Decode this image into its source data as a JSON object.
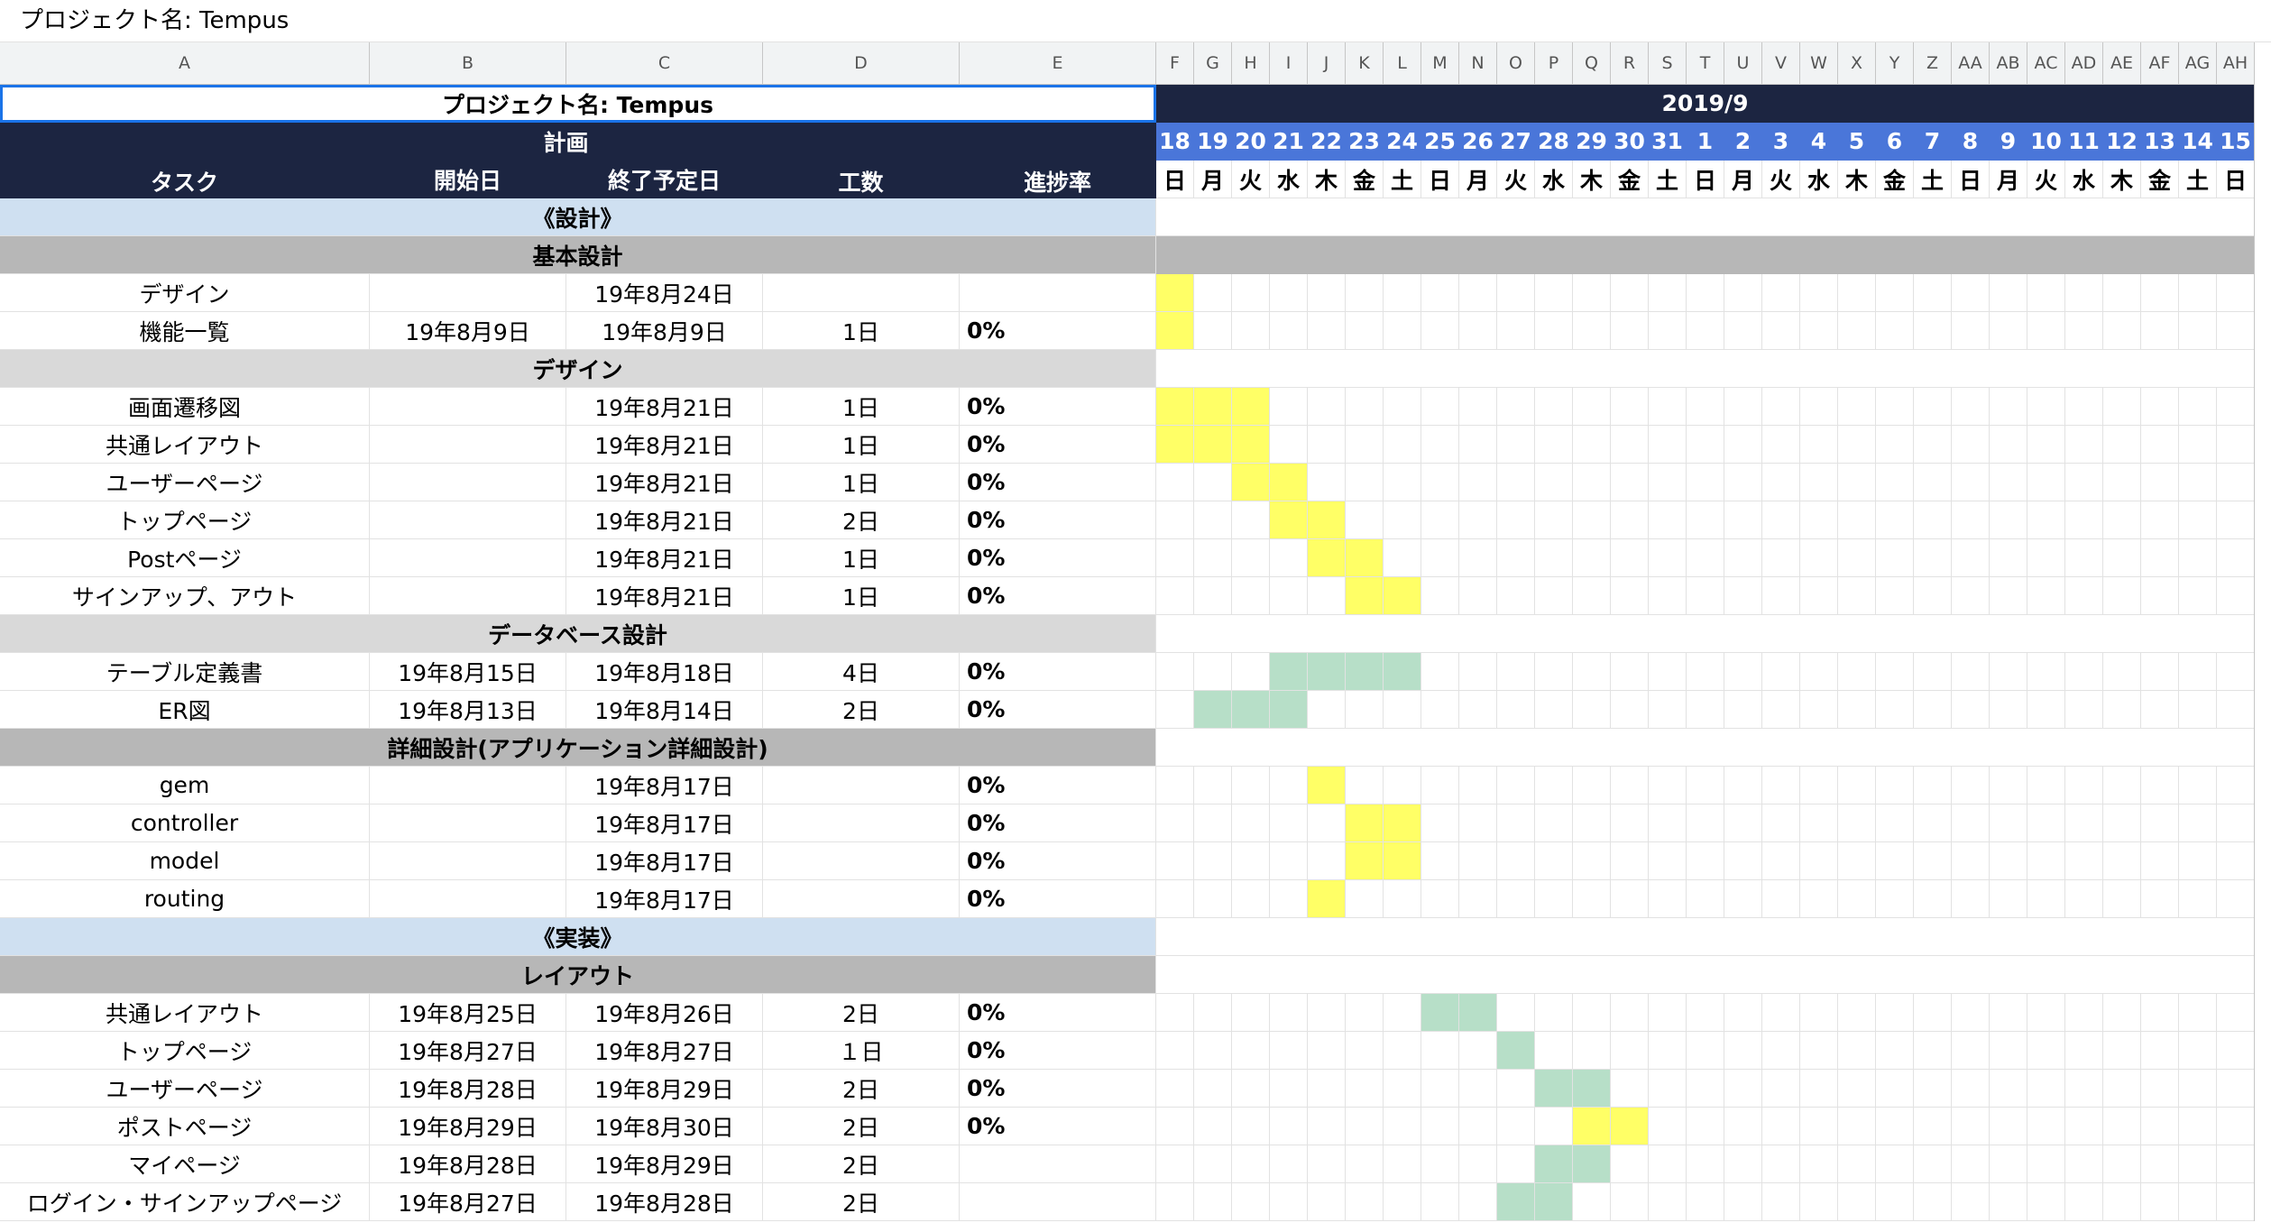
{
  "formula_bar": {
    "value": "プロジェクト名: Tempus"
  },
  "colors": {
    "navy": "#1c2541",
    "date_blue": "#4a76d9",
    "phase_blue": "#cfe0f1",
    "category_dark_gray": "#b7b7b7",
    "category_light_gray": "#d9d9d9",
    "bar_yellow": "#ffff66",
    "bar_green": "#b7dfc8"
  },
  "columns": [
    "A",
    "B",
    "C",
    "D",
    "E",
    "F",
    "G",
    "H",
    "I",
    "J",
    "K",
    "L",
    "M",
    "N",
    "O",
    "P",
    "Q",
    "R",
    "S",
    "T",
    "U",
    "V",
    "W",
    "X",
    "Y",
    "Z",
    "AA",
    "AB",
    "AC",
    "AD",
    "AE",
    "AF",
    "AG",
    "AH"
  ],
  "sheet": {
    "project_title": "プロジェクト名: Tempus",
    "month_label": "2019/9",
    "plan_label": "計画",
    "headers": {
      "task": "タスク",
      "start": "開始日",
      "end": "終了予定日",
      "effort": "工数",
      "progress": "進捗率"
    },
    "dates": [
      "18",
      "19",
      "20",
      "21",
      "22",
      "23",
      "24",
      "25",
      "26",
      "27",
      "28",
      "29",
      "30",
      "31",
      "1",
      "2",
      "3",
      "4",
      "5",
      "6",
      "7",
      "8",
      "9",
      "10",
      "11",
      "12",
      "13",
      "14",
      "15"
    ],
    "weekdays": [
      "日",
      "月",
      "火",
      "水",
      "木",
      "金",
      "土",
      "日",
      "月",
      "火",
      "水",
      "木",
      "金",
      "土",
      "日",
      "月",
      "火",
      "水",
      "木",
      "金",
      "土",
      "日",
      "月",
      "火",
      "水",
      "木",
      "金",
      "土",
      "日"
    ]
  },
  "rows": [
    {
      "type": "phase",
      "label": "《設計》"
    },
    {
      "type": "category",
      "shade": "dark",
      "label": "基本設計",
      "gantt_bar": true
    },
    {
      "type": "task",
      "task": "デザイン",
      "start": "",
      "end": "19年8月24日",
      "effort": "",
      "progress": "",
      "yellow": [
        0
      ],
      "green": []
    },
    {
      "type": "task",
      "task": "機能一覧",
      "start": "19年8月9日",
      "end": "19年8月9日",
      "effort": "1日",
      "progress": "0%",
      "yellow": [
        0
      ],
      "green": []
    },
    {
      "type": "category",
      "shade": "light",
      "label": "デザイン",
      "gantt_bar": false
    },
    {
      "type": "task",
      "task": "画面遷移図",
      "start": "",
      "end": "19年8月21日",
      "effort": "1日",
      "progress": "0%",
      "yellow": [
        0,
        1,
        2
      ],
      "green": []
    },
    {
      "type": "task",
      "task": "共通レイアウト",
      "start": "",
      "end": "19年8月21日",
      "effort": "1日",
      "progress": "0%",
      "yellow": [
        0,
        1,
        2
      ],
      "green": []
    },
    {
      "type": "task",
      "task": "ユーザーページ",
      "start": "",
      "end": "19年8月21日",
      "effort": "1日",
      "progress": "0%",
      "yellow": [
        2,
        3
      ],
      "green": []
    },
    {
      "type": "task",
      "task": "トップページ",
      "start": "",
      "end": "19年8月21日",
      "effort": "2日",
      "progress": "0%",
      "yellow": [
        3,
        4
      ],
      "green": []
    },
    {
      "type": "task",
      "task": "Postページ",
      "start": "",
      "end": "19年8月21日",
      "effort": "1日",
      "progress": "0%",
      "yellow": [
        4,
        5
      ],
      "green": []
    },
    {
      "type": "task",
      "task": "サインアップ、アウト",
      "start": "",
      "end": "19年8月21日",
      "effort": "1日",
      "progress": "0%",
      "yellow": [
        5,
        6
      ],
      "green": []
    },
    {
      "type": "category",
      "shade": "light",
      "label": "データベース設計",
      "gantt_bar": false
    },
    {
      "type": "task",
      "task": "テーブル定義書",
      "start": "19年8月15日",
      "end": "19年8月18日",
      "effort": "4日",
      "progress": "0%",
      "yellow": [],
      "green": [
        3,
        4,
        5,
        6
      ]
    },
    {
      "type": "task",
      "task": "ER図",
      "start": "19年8月13日",
      "end": "19年8月14日",
      "effort": "2日",
      "progress": "0%",
      "yellow": [],
      "green": [
        1,
        2,
        3
      ]
    },
    {
      "type": "category",
      "shade": "dark",
      "label": "詳細設計(アプリケーション詳細設計)",
      "gantt_bar": false
    },
    {
      "type": "task",
      "task": "gem",
      "start": "",
      "end": "19年8月17日",
      "effort": "",
      "progress": "0%",
      "yellow": [
        4
      ],
      "green": []
    },
    {
      "type": "task",
      "task": "controller",
      "start": "",
      "end": "19年8月17日",
      "effort": "",
      "progress": "0%",
      "yellow": [
        5,
        6
      ],
      "green": []
    },
    {
      "type": "task",
      "task": "model",
      "start": "",
      "end": "19年8月17日",
      "effort": "",
      "progress": "0%",
      "yellow": [
        5,
        6
      ],
      "green": []
    },
    {
      "type": "task",
      "task": "routing",
      "start": "",
      "end": "19年8月17日",
      "effort": "",
      "progress": "0%",
      "yellow": [
        4
      ],
      "green": []
    },
    {
      "type": "phase",
      "label": "《実装》"
    },
    {
      "type": "category",
      "shade": "dark",
      "label": "レイアウト",
      "gantt_bar": false
    },
    {
      "type": "task",
      "task": "共通レイアウト",
      "start": "19年8月25日",
      "end": "19年8月26日",
      "effort": "2日",
      "progress": "0%",
      "yellow": [],
      "green": [
        7,
        8
      ]
    },
    {
      "type": "task",
      "task": "トップページ",
      "start": "19年8月27日",
      "end": "19年8月27日",
      "effort": "１日",
      "progress": "0%",
      "yellow": [],
      "green": [
        9
      ]
    },
    {
      "type": "task",
      "task": "ユーザーページ",
      "start": "19年8月28日",
      "end": "19年8月29日",
      "effort": "2日",
      "progress": "0%",
      "yellow": [],
      "green": [
        10,
        11
      ]
    },
    {
      "type": "task",
      "task": "ポストページ",
      "start": "19年8月29日",
      "end": "19年8月30日",
      "effort": "2日",
      "progress": "0%",
      "yellow": [
        11,
        12
      ],
      "green": []
    },
    {
      "type": "task",
      "task": "マイページ",
      "start": "19年8月28日",
      "end": "19年8月29日",
      "effort": "2日",
      "progress": "",
      "yellow": [],
      "green": [
        10,
        11
      ]
    },
    {
      "type": "task",
      "task": "ログイン・サインアップページ",
      "start": "19年8月27日",
      "end": "19年8月28日",
      "effort": "2日",
      "progress": "",
      "yellow": [],
      "green": [
        9,
        10
      ]
    }
  ]
}
